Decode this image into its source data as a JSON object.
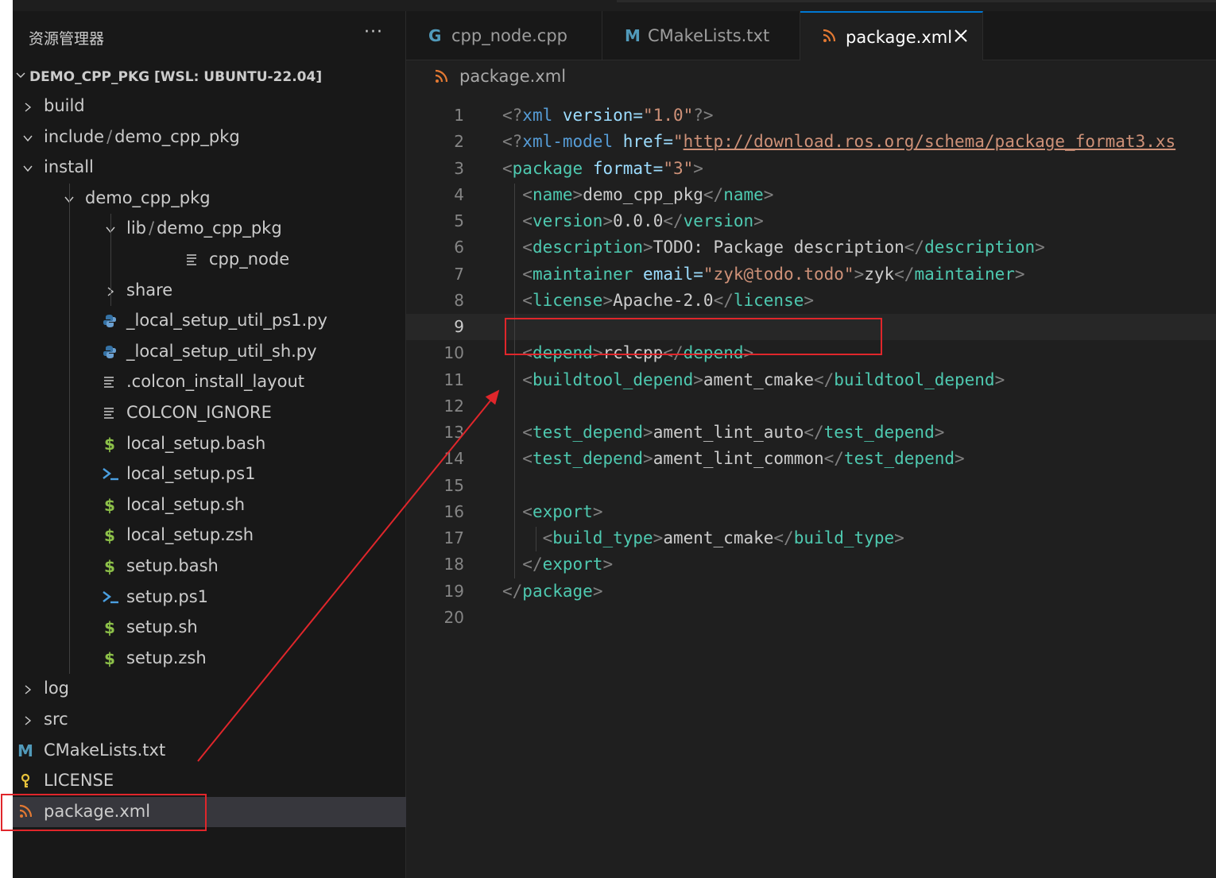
{
  "sidebar": {
    "title": "资源管理器",
    "more_label": "···",
    "root_label": "DEMO_CPP_PKG [WSL: UBUNTU-22.04]",
    "items": [
      {
        "label": "build",
        "parts": null,
        "icon": "chevron-right-icon"
      },
      {
        "label": "include",
        "parts": [
          "include",
          "demo_cpp_pkg"
        ],
        "icon": "chevron-down-icon"
      },
      {
        "label": "install",
        "parts": null,
        "icon": "chevron-down-icon"
      },
      {
        "label": "demo_cpp_pkg",
        "parts": null,
        "icon": "chevron-down-icon"
      },
      {
        "label": "lib",
        "parts": [
          "lib",
          "demo_cpp_pkg"
        ],
        "icon": "chevron-down-icon"
      },
      {
        "label": "cpp_node",
        "parts": null,
        "icon": "file-lines-icon"
      },
      {
        "label": "share",
        "parts": null,
        "icon": "chevron-right-icon"
      },
      {
        "label": "_local_setup_util_ps1.py",
        "parts": null,
        "icon": "python-icon"
      },
      {
        "label": "_local_setup_util_sh.py",
        "parts": null,
        "icon": "python-icon"
      },
      {
        "label": ".colcon_install_layout",
        "parts": null,
        "icon": "file-lines-icon"
      },
      {
        "label": "COLCON_IGNORE",
        "parts": null,
        "icon": "file-lines-icon"
      },
      {
        "label": "local_setup.bash",
        "parts": null,
        "icon": "shell-dollar-icon"
      },
      {
        "label": "local_setup.ps1",
        "parts": null,
        "icon": "powershell-icon"
      },
      {
        "label": "local_setup.sh",
        "parts": null,
        "icon": "shell-dollar-icon"
      },
      {
        "label": "local_setup.zsh",
        "parts": null,
        "icon": "shell-dollar-icon"
      },
      {
        "label": "setup.bash",
        "parts": null,
        "icon": "shell-dollar-icon"
      },
      {
        "label": "setup.ps1",
        "parts": null,
        "icon": "powershell-icon"
      },
      {
        "label": "setup.sh",
        "parts": null,
        "icon": "shell-dollar-icon"
      },
      {
        "label": "setup.zsh",
        "parts": null,
        "icon": "shell-dollar-icon"
      },
      {
        "label": "log",
        "parts": null,
        "icon": "chevron-right-icon"
      },
      {
        "label": "src",
        "parts": null,
        "icon": "chevron-right-icon"
      },
      {
        "label": "CMakeLists.txt",
        "parts": null,
        "icon": "cmake-icon"
      },
      {
        "label": "LICENSE",
        "parts": null,
        "icon": "license-key-icon"
      },
      {
        "label": "package.xml",
        "parts": null,
        "icon": "rss-xml-icon",
        "selected": true
      }
    ]
  },
  "tabs": [
    {
      "label": "cpp_node.cpp",
      "icon": "cpp-icon",
      "active": false
    },
    {
      "label": "CMakeLists.txt",
      "icon": "cmake-icon",
      "active": false
    },
    {
      "label": "package.xml",
      "icon": "rss-xml-icon",
      "active": true
    }
  ],
  "close_glyph": "×",
  "breadcrumb": {
    "label": "package.xml",
    "icon": "rss-xml-icon"
  },
  "editor": {
    "current_line": 9,
    "lines": [
      {
        "n": "1",
        "text": "<?xml version=\"1.0\"?>"
      },
      {
        "n": "2",
        "text": "<?xml-model href=\"http://download.ros.org/schema/package_format3.xs"
      },
      {
        "n": "3",
        "text": "<package format=\"3\">"
      },
      {
        "n": "4",
        "text": "  <name>demo_cpp_pkg</name>"
      },
      {
        "n": "5",
        "text": "  <version>0.0.0</version>"
      },
      {
        "n": "6",
        "text": "  <description>TODO: Package description</description>"
      },
      {
        "n": "7",
        "text": "  <maintainer email=\"zyk@todo.todo\">zyk</maintainer>"
      },
      {
        "n": "8",
        "text": "  <license>Apache-2.0</license>"
      },
      {
        "n": "9",
        "text": ""
      },
      {
        "n": "10",
        "text": "  <depend>rclcpp</depend>"
      },
      {
        "n": "11",
        "text": "  <buildtool_depend>ament_cmake</buildtool_depend>"
      },
      {
        "n": "12",
        "text": ""
      },
      {
        "n": "13",
        "text": "  <test_depend>ament_lint_auto</test_depend>"
      },
      {
        "n": "14",
        "text": "  <test_depend>ament_lint_common</test_depend>"
      },
      {
        "n": "15",
        "text": ""
      },
      {
        "n": "16",
        "text": "  <export>"
      },
      {
        "n": "17",
        "text": "    <build_type>ament_cmake</build_type>"
      },
      {
        "n": "18",
        "text": "  </export>"
      },
      {
        "n": "19",
        "text": "</package>"
      },
      {
        "n": "20",
        "text": ""
      }
    ]
  },
  "colors": {
    "annotation_red": "#e0262b",
    "accent_blue": "#0078d4",
    "xml_orange": "#e37933",
    "shell_green": "#8dc149",
    "python_blue": "#3572a5",
    "cmake_blue": "#519aba"
  }
}
